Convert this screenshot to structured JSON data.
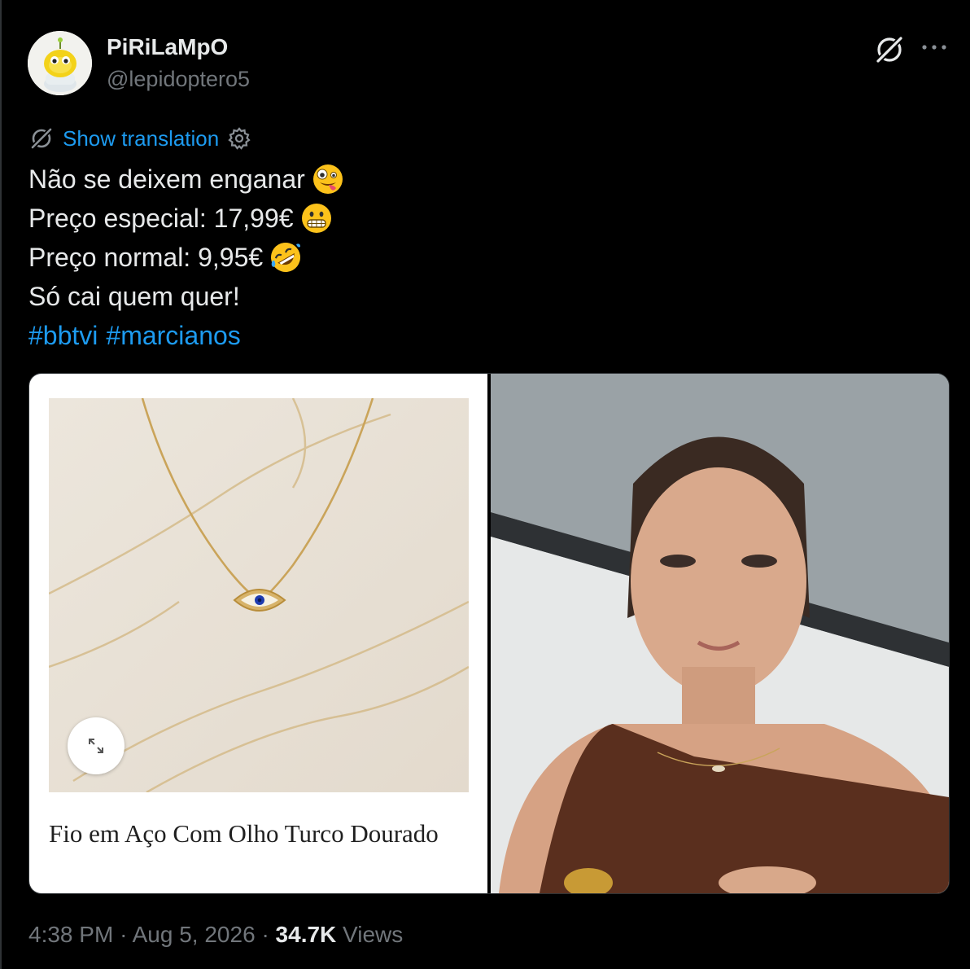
{
  "author": {
    "display_name": "PiRiLaMpO",
    "handle": "@lepidoptero5",
    "avatar_icon": "yellow-alien-toy-icon"
  },
  "header_actions": {
    "grok_icon": "grok-icon",
    "more_icon": "more-icon",
    "more_label": "•••"
  },
  "translation": {
    "label": "Show translation",
    "icon": "translate-icon",
    "settings_icon": "gear-icon"
  },
  "tweet": {
    "lines": [
      {
        "text": "Não se deixem enganar",
        "emoji": "zany-face-emoji"
      },
      {
        "text": "Preço especial: 17,99€",
        "emoji": "grimacing-face-emoji"
      },
      {
        "text": "Preço normal: 9,95€",
        "emoji": "rofl-emoji"
      },
      {
        "text": "Só cai quem quer!",
        "emoji": ""
      }
    ],
    "hashtags": [
      "#bbtvi",
      "#marcianos"
    ]
  },
  "media": {
    "left": {
      "product_title": "Fio em Aço Com Olho Turco Dourado",
      "image": "gold-evil-eye-necklace-on-marble",
      "expand_icon": "expand-icon"
    },
    "right": {
      "image": "woman-wearing-necklace-video-frame"
    }
  },
  "meta": {
    "time": "4:38 PM",
    "separator": "·",
    "date": "Aug 5, 2026",
    "views_count": "34.7K",
    "views_label": "Views"
  },
  "colors": {
    "background": "#000000",
    "text": "#e7e9ea",
    "secondary": "#71767b",
    "accent": "#1d9bf0",
    "border": "#2f3336"
  }
}
